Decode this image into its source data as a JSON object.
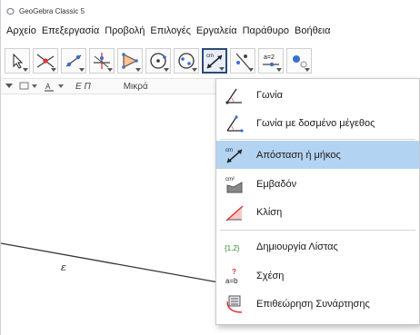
{
  "window": {
    "title": "GeoGebra Classic 5"
  },
  "menu": [
    "Αρχείο",
    "Επεξεργασία",
    "Προβολή",
    "Επιλογές",
    "Εργαλεία",
    "Παράθυρο",
    "Βοήθεια"
  ],
  "toolbar": {
    "tools": [
      {
        "name": "move-tool",
        "icon": "arrow-cursor-icon"
      },
      {
        "name": "point-tool",
        "icon": "point-intersect-icon"
      },
      {
        "name": "line-tool",
        "icon": "line-icon"
      },
      {
        "name": "perpendicular-tool",
        "icon": "perpendicular-icon"
      },
      {
        "name": "polygon-tool",
        "icon": "polygon-icon"
      },
      {
        "name": "circle-tool",
        "icon": "circle-icon"
      },
      {
        "name": "arc-tool",
        "icon": "circle-arc-icon"
      },
      {
        "name": "measure-tool",
        "icon": "distance-icon",
        "active": true
      },
      {
        "name": "reflect-tool",
        "icon": "reflect-icon"
      },
      {
        "name": "slider-tool",
        "icon": "slider-icon",
        "text": "a=2"
      },
      {
        "name": "view-tool",
        "icon": "view-dots-icon"
      }
    ]
  },
  "stylebar": {
    "font_size": "Μικρά",
    "style_label": "Ε Π"
  },
  "graphics": {
    "line_label": "ε"
  },
  "dropdown": {
    "items": [
      {
        "label": "Γωνία",
        "icon": "angle-icon"
      },
      {
        "label": "Γωνία με δοσμένο μέγεθος",
        "icon": "angle-given-size-icon"
      },
      {
        "label": "Απόσταση ή μήκος",
        "icon": "distance-length-icon",
        "selected": true
      },
      {
        "label": "Εμβαδόν",
        "icon": "area-icon"
      },
      {
        "label": "Κλίση",
        "icon": "slope-icon"
      },
      {
        "label": "Δημιουργία Λίστας",
        "icon": "list-icon",
        "icon_text": "{1,2}"
      },
      {
        "label": "Σχέση",
        "icon": "relation-icon",
        "icon_text": "a=b"
      },
      {
        "label": "Επιθεώρηση Συνάρτησης",
        "icon": "function-inspector-icon"
      }
    ],
    "area_icon_text": "cm²",
    "distance_icon_text": "cm"
  },
  "colors": {
    "accent": "#2b4a78",
    "selection": "#b3d3f2",
    "point_red": "#e03030",
    "line": "#333333"
  }
}
